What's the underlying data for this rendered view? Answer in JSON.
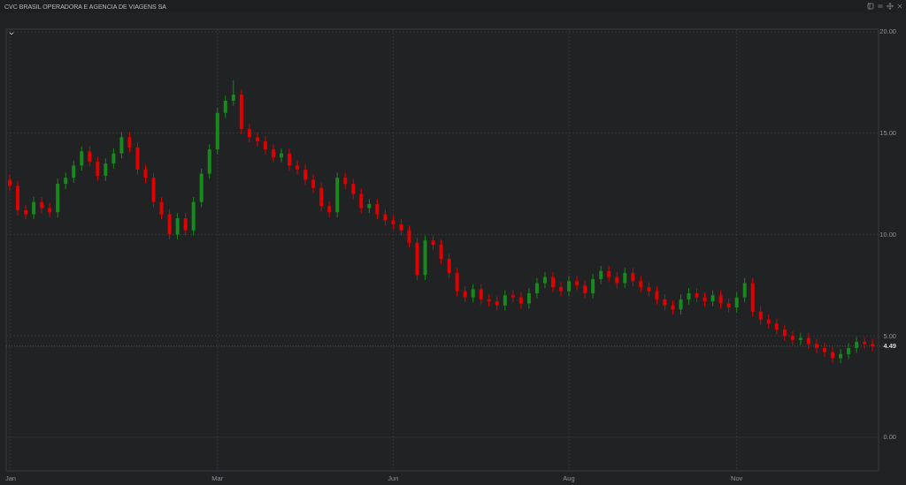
{
  "window": {
    "title": "CVC BRASIL OPERADORA E AGENCIA DE VIAGENS SA"
  },
  "chart": {
    "chart_data": {
      "type": "candlestick",
      "grid": true,
      "ylim": [
        -1.66,
        20.13
      ],
      "yticks": [
        {
          "value": 0,
          "label": "0.00"
        },
        {
          "value": 5,
          "label": "5.00"
        },
        {
          "value": 10,
          "label": "10.00"
        },
        {
          "value": 15,
          "label": "15.00"
        },
        {
          "value": 20,
          "label": "20.00"
        }
      ],
      "ref_lines": [
        {
          "axis": "y",
          "value": 4.49,
          "label": "4.49"
        }
      ],
      "categories": [
        "Jan",
        null,
        null,
        null,
        null,
        null,
        null,
        null,
        null,
        null,
        null,
        null,
        null,
        null,
        null,
        null,
        null,
        null,
        null,
        null,
        null,
        null,
        null,
        null,
        null,
        null,
        "Mar",
        null,
        null,
        null,
        null,
        null,
        null,
        null,
        null,
        null,
        null,
        null,
        null,
        null,
        null,
        null,
        null,
        null,
        null,
        null,
        null,
        null,
        "Jun",
        null,
        null,
        null,
        null,
        null,
        null,
        null,
        null,
        null,
        null,
        null,
        null,
        null,
        null,
        null,
        null,
        null,
        null,
        null,
        null,
        null,
        "Aug",
        null,
        null,
        null,
        null,
        null,
        null,
        null,
        null,
        null,
        null,
        null,
        null,
        null,
        null,
        null,
        null,
        null,
        null,
        null,
        null,
        "Nov",
        null,
        null,
        null,
        null,
        null,
        null,
        null,
        null,
        null,
        null,
        null,
        null,
        null,
        null,
        null,
        null,
        null
      ],
      "ohlc": [
        [
          12.7,
          12.95,
          12.15,
          12.4
        ],
        [
          12.4,
          12.65,
          10.95,
          11.2
        ],
        [
          11.2,
          11.45,
          10.75,
          11.0
        ],
        [
          11.0,
          11.85,
          10.75,
          11.6
        ],
        [
          11.6,
          11.85,
          11.05,
          11.3
        ],
        [
          11.3,
          11.55,
          10.85,
          11.1
        ],
        [
          11.1,
          12.75,
          10.85,
          12.5
        ],
        [
          12.5,
          13.05,
          12.25,
          12.8
        ],
        [
          12.8,
          13.65,
          12.55,
          13.4
        ],
        [
          13.4,
          14.35,
          13.15,
          14.1
        ],
        [
          14.1,
          14.35,
          13.35,
          13.6
        ],
        [
          13.6,
          13.85,
          12.65,
          12.9
        ],
        [
          12.9,
          13.75,
          12.65,
          13.5
        ],
        [
          13.5,
          14.25,
          13.25,
          14.0
        ],
        [
          14.0,
          15.05,
          13.75,
          14.8
        ],
        [
          14.8,
          15.05,
          14.05,
          14.3
        ],
        [
          14.3,
          14.55,
          12.95,
          13.2
        ],
        [
          13.2,
          13.45,
          12.55,
          12.8
        ],
        [
          12.8,
          13.05,
          11.35,
          11.6
        ],
        [
          11.6,
          11.85,
          10.75,
          11.0
        ],
        [
          11.0,
          11.25,
          9.75,
          10.0
        ],
        [
          10.0,
          11.05,
          9.75,
          10.8
        ],
        [
          10.8,
          11.05,
          9.95,
          10.2
        ],
        [
          10.2,
          11.85,
          9.95,
          11.6
        ],
        [
          11.6,
          13.25,
          11.35,
          13.0
        ],
        [
          13.0,
          14.45,
          12.75,
          14.2
        ],
        [
          14.2,
          16.25,
          13.95,
          16.0
        ],
        [
          16.0,
          16.85,
          15.75,
          16.6
        ],
        [
          16.6,
          17.6,
          16.35,
          16.9
        ],
        [
          16.9,
          17.15,
          14.95,
          15.2
        ],
        [
          15.2,
          15.45,
          14.55,
          14.8
        ],
        [
          14.8,
          15.05,
          14.35,
          14.6
        ],
        [
          14.6,
          14.85,
          13.95,
          14.2
        ],
        [
          14.2,
          14.45,
          13.55,
          13.8
        ],
        [
          13.8,
          14.25,
          13.55,
          14.0
        ],
        [
          14.0,
          14.25,
          13.15,
          13.4
        ],
        [
          13.4,
          13.65,
          12.95,
          13.2
        ],
        [
          13.2,
          13.45,
          12.45,
          12.7
        ],
        [
          12.7,
          12.95,
          12.05,
          12.3
        ],
        [
          12.3,
          12.55,
          11.15,
          11.4
        ],
        [
          11.4,
          11.65,
          10.85,
          11.1
        ],
        [
          11.1,
          13.05,
          10.85,
          12.8
        ],
        [
          12.8,
          13.05,
          12.25,
          12.5
        ],
        [
          12.5,
          12.75,
          11.75,
          12.0
        ],
        [
          12.0,
          12.25,
          11.05,
          11.3
        ],
        [
          11.3,
          11.75,
          11.05,
          11.5
        ],
        [
          11.5,
          11.75,
          10.75,
          11.0
        ],
        [
          11.0,
          11.25,
          10.45,
          10.7
        ],
        [
          10.7,
          10.95,
          10.25,
          10.5
        ],
        [
          10.5,
          10.75,
          9.95,
          10.2
        ],
        [
          10.2,
          10.45,
          9.35,
          9.6
        ],
        [
          9.6,
          9.85,
          7.75,
          8.0
        ],
        [
          8.0,
          9.95,
          7.75,
          9.7
        ],
        [
          9.7,
          9.95,
          9.25,
          9.5
        ],
        [
          9.5,
          9.75,
          8.55,
          8.8
        ],
        [
          8.8,
          9.05,
          7.85,
          8.1
        ],
        [
          8.1,
          8.35,
          6.95,
          7.2
        ],
        [
          7.2,
          7.45,
          6.65,
          6.9
        ],
        [
          6.9,
          7.55,
          6.65,
          7.3
        ],
        [
          7.3,
          7.55,
          6.55,
          6.8
        ],
        [
          6.8,
          7.05,
          6.45,
          6.7
        ],
        [
          6.7,
          6.95,
          6.25,
          6.5
        ],
        [
          6.5,
          7.25,
          6.25,
          7.0
        ],
        [
          7.0,
          7.25,
          6.65,
          6.9
        ],
        [
          6.9,
          7.15,
          6.35,
          6.6
        ],
        [
          6.6,
          7.35,
          6.35,
          7.1
        ],
        [
          7.1,
          7.85,
          6.85,
          7.6
        ],
        [
          7.6,
          8.15,
          7.35,
          7.9
        ],
        [
          7.9,
          8.15,
          7.15,
          7.4
        ],
        [
          7.4,
          7.65,
          6.95,
          7.2
        ],
        [
          7.2,
          7.95,
          6.95,
          7.7
        ],
        [
          7.7,
          7.95,
          7.25,
          7.5
        ],
        [
          7.5,
          7.75,
          6.85,
          7.1
        ],
        [
          7.1,
          8.05,
          6.85,
          7.8
        ],
        [
          7.8,
          8.45,
          7.55,
          8.2
        ],
        [
          8.2,
          8.45,
          7.65,
          7.9
        ],
        [
          7.9,
          8.15,
          7.35,
          7.6
        ],
        [
          7.6,
          8.35,
          7.35,
          8.1
        ],
        [
          8.1,
          8.35,
          7.45,
          7.7
        ],
        [
          7.7,
          7.95,
          7.15,
          7.4
        ],
        [
          7.4,
          7.65,
          6.95,
          7.2
        ],
        [
          7.2,
          7.45,
          6.55,
          6.8
        ],
        [
          6.8,
          7.05,
          6.25,
          6.5
        ],
        [
          6.5,
          6.75,
          6.05,
          6.3
        ],
        [
          6.3,
          7.05,
          6.05,
          6.8
        ],
        [
          6.8,
          7.35,
          6.55,
          7.1
        ],
        [
          7.1,
          7.35,
          6.65,
          6.9
        ],
        [
          6.9,
          7.15,
          6.45,
          6.7
        ],
        [
          6.7,
          7.25,
          6.45,
          7.0
        ],
        [
          7.0,
          7.25,
          6.35,
          6.6
        ],
        [
          6.6,
          6.85,
          6.15,
          6.4
        ],
        [
          6.4,
          7.15,
          6.15,
          6.9
        ],
        [
          6.9,
          7.85,
          6.65,
          7.6
        ],
        [
          7.6,
          7.85,
          5.95,
          6.2
        ],
        [
          6.2,
          6.45,
          5.55,
          5.8
        ],
        [
          5.8,
          6.05,
          5.35,
          5.6
        ],
        [
          5.6,
          5.85,
          5.05,
          5.3
        ],
        [
          5.3,
          5.55,
          4.75,
          5.0
        ],
        [
          5.0,
          5.25,
          4.55,
          4.8
        ],
        [
          4.8,
          5.15,
          4.55,
          4.9
        ],
        [
          4.9,
          5.15,
          4.35,
          4.6
        ],
        [
          4.6,
          4.85,
          4.15,
          4.4
        ],
        [
          4.4,
          4.65,
          3.95,
          4.2
        ],
        [
          4.2,
          4.45,
          3.65,
          3.9
        ],
        [
          3.9,
          4.35,
          3.65,
          4.1
        ],
        [
          4.1,
          4.65,
          3.85,
          4.4
        ],
        [
          4.4,
          4.95,
          4.15,
          4.7
        ],
        [
          4.7,
          4.95,
          4.35,
          4.6
        ],
        [
          4.6,
          4.85,
          4.24,
          4.49
        ]
      ]
    }
  }
}
